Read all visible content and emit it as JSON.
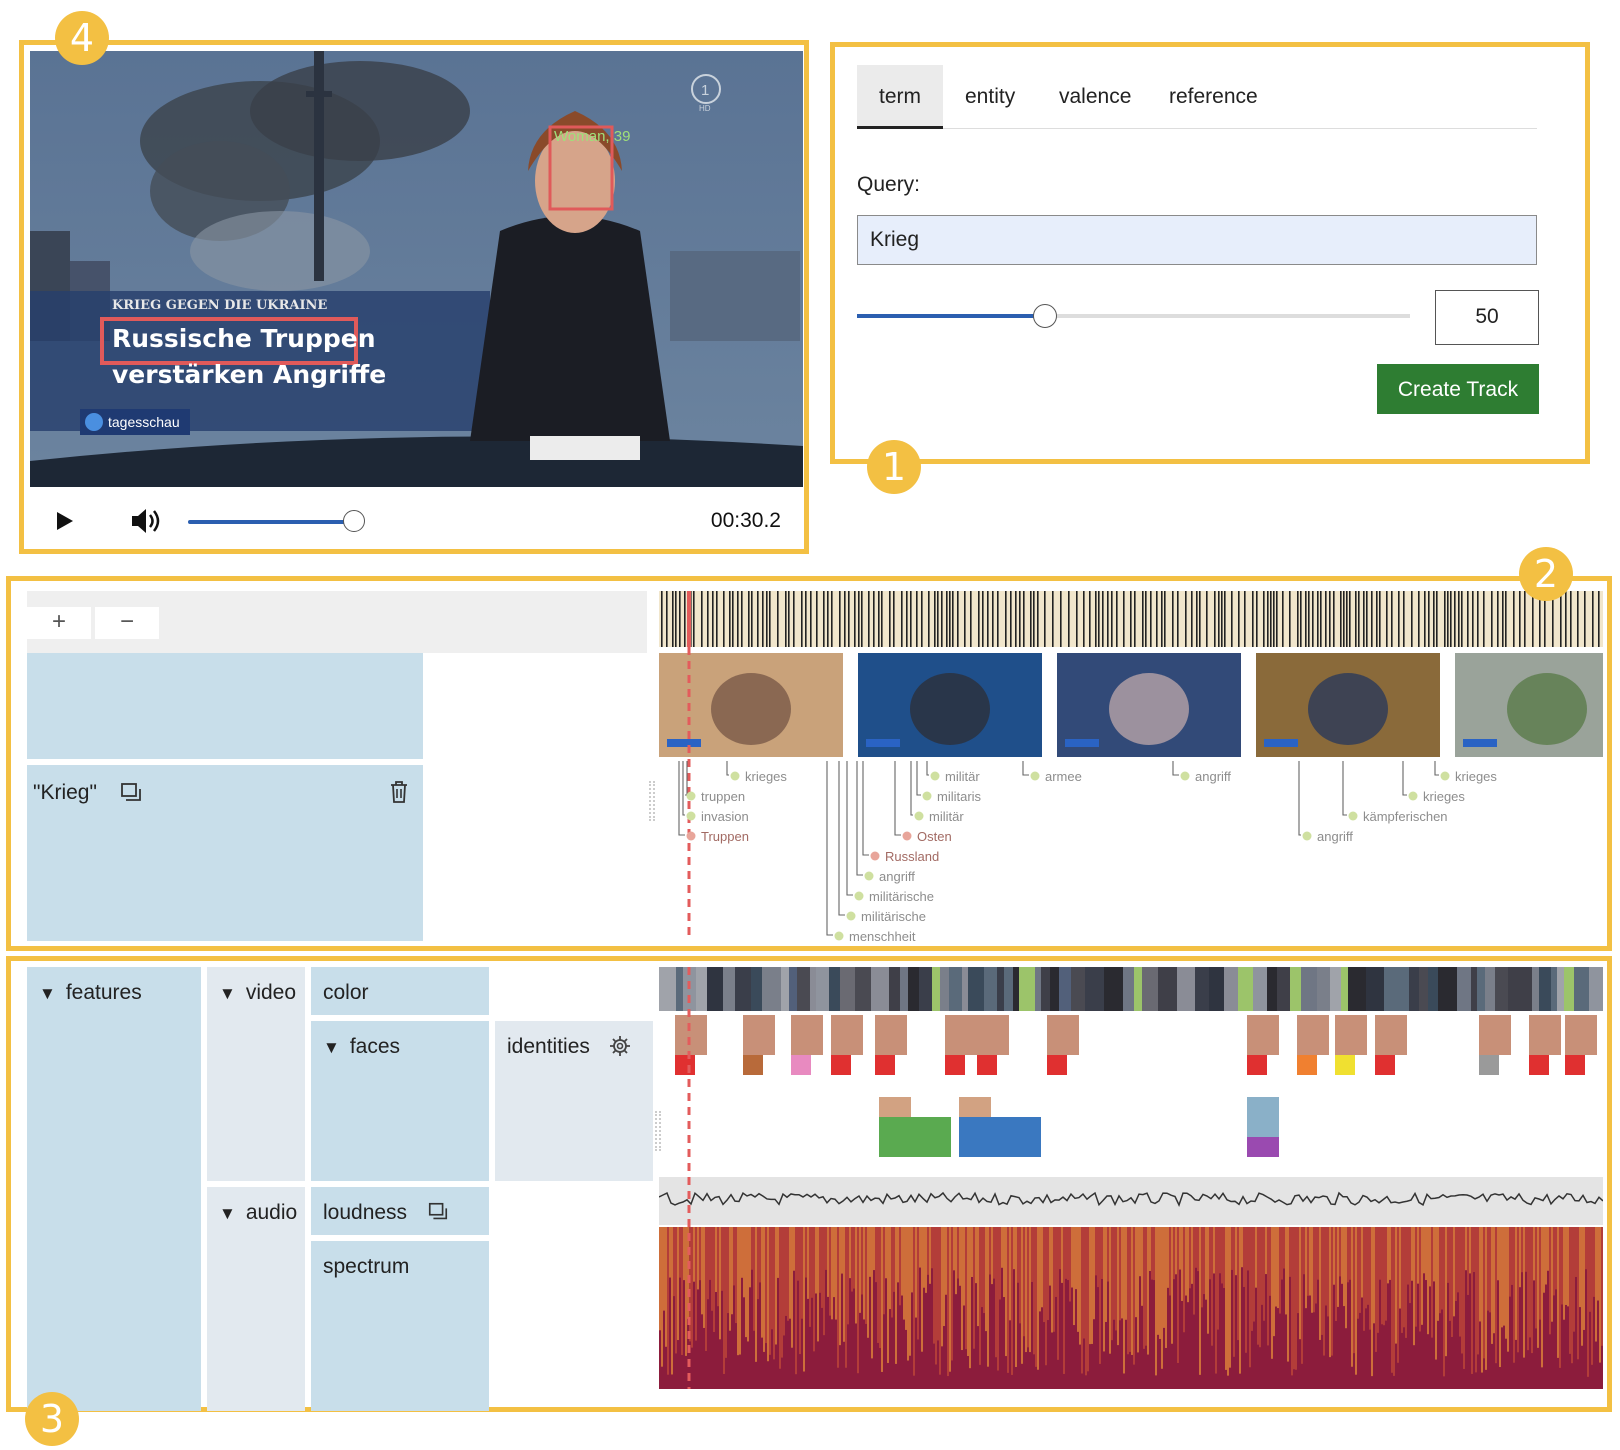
{
  "badges": {
    "query": "1",
    "tracks": "2",
    "features": "3",
    "video": "4"
  },
  "video": {
    "overlay_face_label": "Woman, 39",
    "ticker_top": "KRIEG GEGEN DIE UKRAINE",
    "headline_line1": "Russische Truppen",
    "headline_line2": "verstärken Angriffe",
    "channel_logo": "tagesschau",
    "corner_logo": "1",
    "corner_logo_sub": "HD",
    "time": "00:30.2",
    "playback_progress": 0.21
  },
  "query_panel": {
    "tabs": [
      {
        "label": "term",
        "active": true
      },
      {
        "label": "entity",
        "active": false
      },
      {
        "label": "valence",
        "active": false
      },
      {
        "label": "reference",
        "active": false
      }
    ],
    "query_label": "Query:",
    "query_value": "Krieg",
    "slider_value": "50",
    "slider_fraction": 0.34,
    "create_button": "Create Track"
  },
  "track_panel": {
    "zoom_in": "+",
    "zoom_out": "−",
    "track_label": "\"Krieg\"",
    "terms": [
      {
        "text": "krieges",
        "color": "#cfe0a0"
      },
      {
        "text": "truppen",
        "color": "#cfe0a0"
      },
      {
        "text": "invasion",
        "color": "#cfe0a0"
      },
      {
        "text": "Truppen",
        "color": "#e8a59a"
      },
      {
        "text": "militär",
        "color": "#cfe0a0"
      },
      {
        "text": "militaris",
        "color": "#cfe0a0"
      },
      {
        "text": "militär",
        "color": "#cfe0a0"
      },
      {
        "text": "Osten",
        "color": "#e8a59a"
      },
      {
        "text": "Russland",
        "color": "#e8a59a"
      },
      {
        "text": "angriff",
        "color": "#cfe0a0"
      },
      {
        "text": "militärische",
        "color": "#cfe0a0"
      },
      {
        "text": "militärische",
        "color": "#cfe0a0"
      },
      {
        "text": "menschheit",
        "color": "#cfe0a0"
      },
      {
        "text": "armee",
        "color": "#cfe0a0"
      },
      {
        "text": "angriff",
        "color": "#cfe0a0"
      },
      {
        "text": "angriff",
        "color": "#cfe0a0"
      },
      {
        "text": "krieges",
        "color": "#cfe0a0"
      },
      {
        "text": "krieges",
        "color": "#cfe0a0"
      },
      {
        "text": "kämpferischen",
        "color": "#cfe0a0"
      }
    ]
  },
  "feature_panel": {
    "features": "features",
    "video": "video",
    "audio": "audio",
    "color": "color",
    "faces": "faces",
    "identities": "identities",
    "loudness": "loudness",
    "spectrum": "spectrum"
  },
  "colors": {
    "highlight": "#f3c043",
    "accent_blue": "#2b5fb0",
    "create_green": "#2e7d32",
    "panel_blue": "#c8deea",
    "playhead": "#e35c5c"
  },
  "icons": [
    "play-icon",
    "volume-icon",
    "copy-icon",
    "trash-icon",
    "gear-icon",
    "triangle-down-icon"
  ]
}
